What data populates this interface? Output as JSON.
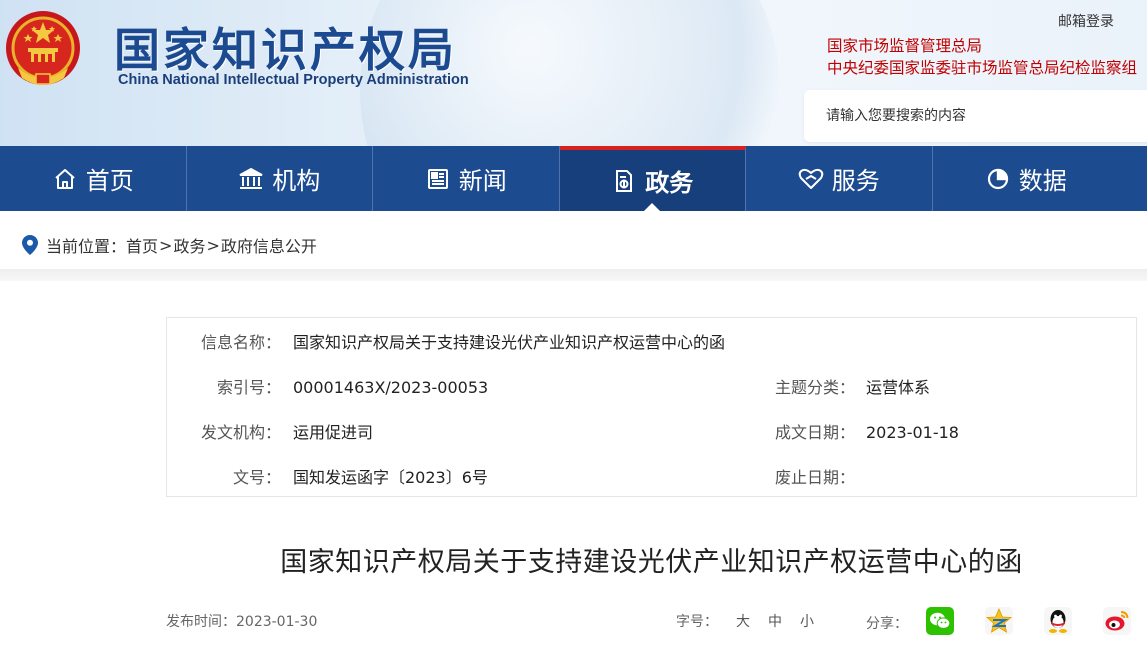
{
  "header": {
    "site_title": "国家知识产权局",
    "site_subtitle": "China National Intellectual Property Administration",
    "mail_login": "邮箱登录",
    "links": [
      "国家市场监督管理总局",
      "中央纪委国家监委驻市场监管总局纪检监察组"
    ],
    "search_placeholder": "请输入您要搜索的内容",
    "emblem_icon": "national-emblem-icon"
  },
  "nav": {
    "items": [
      {
        "label": "首页",
        "icon": "home-icon"
      },
      {
        "label": "机构",
        "icon": "institution-icon"
      },
      {
        "label": "新闻",
        "icon": "news-icon"
      },
      {
        "label": "政务",
        "icon": "government-affairs-icon",
        "active": true
      },
      {
        "label": "服务",
        "icon": "service-icon"
      },
      {
        "label": "数据",
        "icon": "data-chart-icon"
      }
    ],
    "active_color": "#d7211e",
    "bar_color": "#1c4b90"
  },
  "breadcrumb": {
    "prefix": "当前位置：",
    "items": [
      "首页",
      "政务",
      "政府信息公开"
    ],
    "separator": ">"
  },
  "info": {
    "name_label": "信息名称：",
    "name_value": "国家知识产权局关于支持建设光伏产业知识产权运营中心的函",
    "index_label": "索引号：",
    "index_value": "00001463X/2023-00053",
    "topic_label": "主题分类：",
    "topic_value": "运营体系",
    "issuer_label": "发文机构：",
    "issuer_value": "运用促进司",
    "date_label": "成文日期：",
    "date_value": "2023-01-18",
    "docno_label": "文号：",
    "docno_value": "国知发运函字〔2023〕6号",
    "expire_label": "废止日期：",
    "expire_value": ""
  },
  "article": {
    "title": "国家知识产权局关于支持建设光伏产业知识产权运营中心的函",
    "publish_label": "发布时间：",
    "publish_date": "2023-01-30",
    "fontsize_label": "字号：",
    "fontsize_options": [
      "大",
      "中",
      "小"
    ],
    "share_label": "分享："
  }
}
